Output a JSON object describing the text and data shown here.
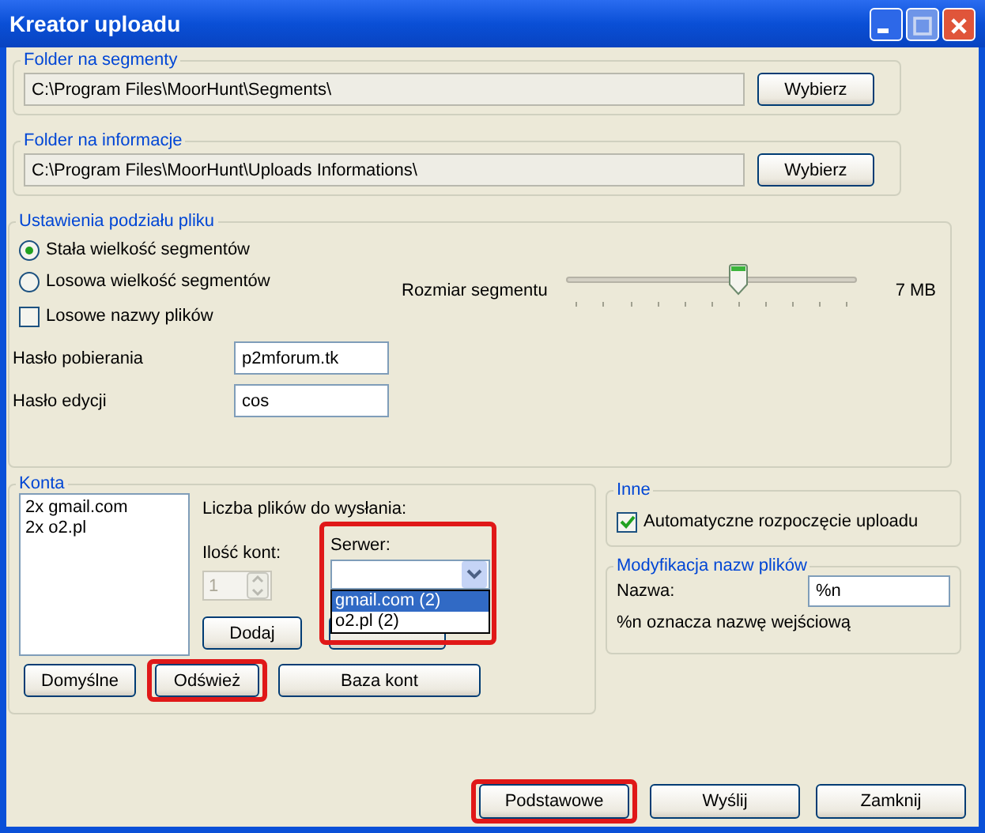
{
  "window": {
    "title": "Kreator uploadu"
  },
  "folder_segments": {
    "label": "Folder na segmenty",
    "path": "C:\\Program Files\\MoorHunt\\Segments\\",
    "button": "Wybierz"
  },
  "folder_info": {
    "label": "Folder na informacje",
    "path": "C:\\Program Files\\MoorHunt\\Uploads Informations\\",
    "button": "Wybierz"
  },
  "split_settings": {
    "label": "Ustawienia podziału pliku",
    "options": [
      {
        "label": "Stała wielkość segmentów",
        "selected": true
      },
      {
        "label": "Losowa wielkość segmentów",
        "selected": false
      }
    ],
    "random_names": {
      "label": "Losowe nazwy plików",
      "checked": false
    },
    "segment_size": {
      "label": "Rozmiar segmentu",
      "level": 0.59,
      "reading": "7 MB"
    },
    "passwords": [
      {
        "label": "Hasło pobierania",
        "value": "p2mforum.tk"
      },
      {
        "label": "Hasło edycji",
        "value": "cos"
      }
    ]
  },
  "accounts": {
    "label": "Konta",
    "list": [
      "2x gmail.com",
      "2x o2.pl"
    ],
    "files_label": "Liczba plików do wysłania:",
    "count_label": "Ilość kont:",
    "count_value": "1",
    "count_disabled": true,
    "server_label": "Serwer:",
    "server_highlighted": true,
    "server_options": [
      {
        "label": "gmail.com (2)",
        "selected": true
      },
      {
        "label": "o2.pl (2)",
        "selected": false
      }
    ],
    "add_button": "Dodaj",
    "buttons": [
      {
        "label": "Domyślne",
        "highlighted": false
      },
      {
        "label": "Odśwież",
        "highlighted": true
      },
      {
        "label": "Baza kont",
        "highlighted": false
      }
    ]
  },
  "other": {
    "label": "Inne",
    "auto_start": {
      "label": "Automatyczne rozpoczęcie uploadu",
      "checked": true
    }
  },
  "rename": {
    "label": "Modyfikacja nazw plików",
    "name_label": "Nazwa:",
    "name_value": "%n",
    "hint": "%n oznacza nazwę wejściową"
  },
  "footer_buttons": [
    {
      "label": "Podstawowe",
      "highlighted": true
    },
    {
      "label": "Wyślij",
      "highlighted": false
    },
    {
      "label": "Zamknij",
      "highlighted": false
    }
  ]
}
